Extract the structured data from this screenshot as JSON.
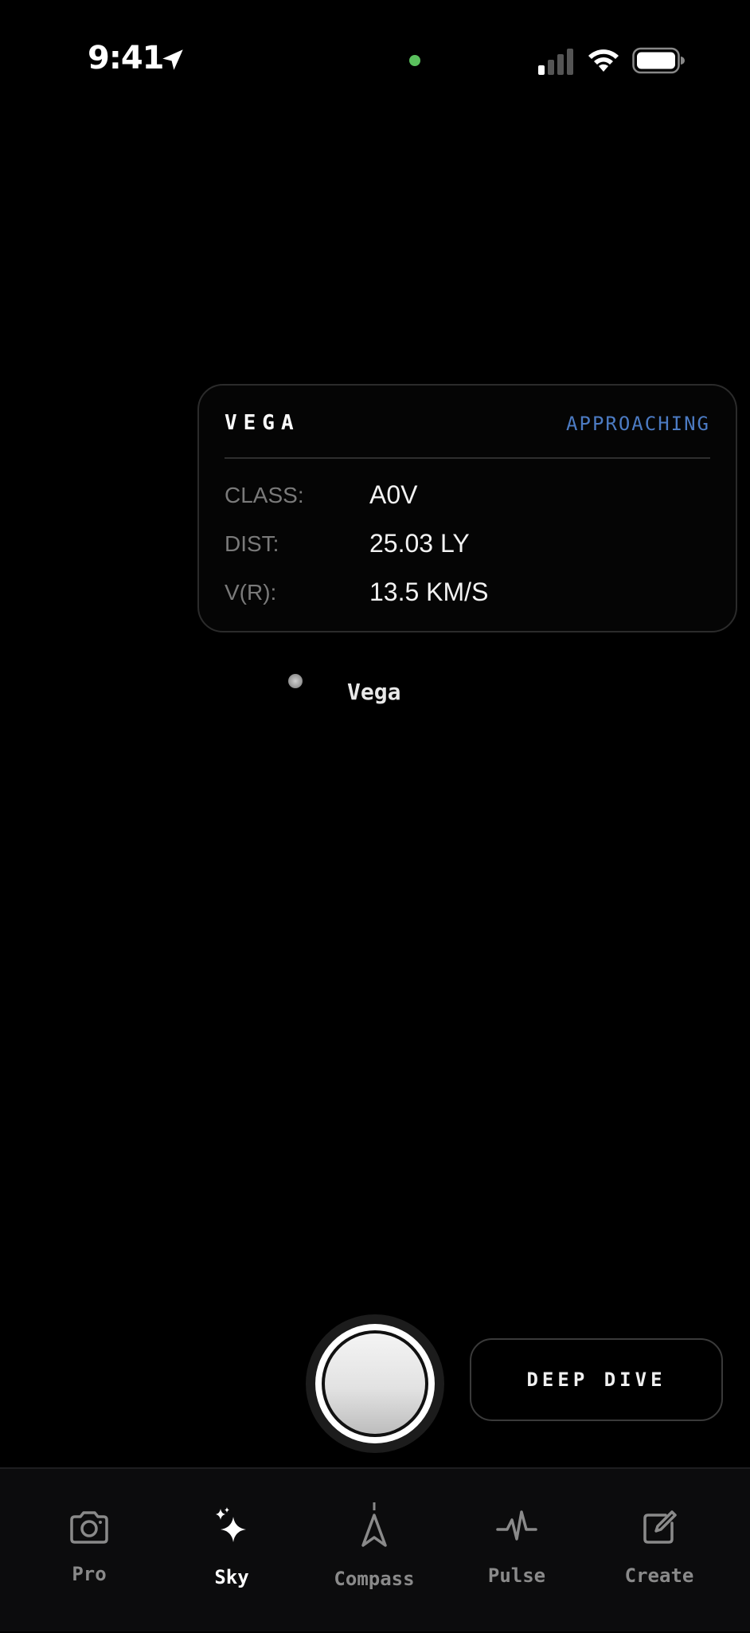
{
  "status_bar": {
    "time": "9:41",
    "icons": [
      "location-arrow-icon",
      "camera-indicator-dot",
      "cellular-signal-icon",
      "wifi-icon",
      "battery-icon"
    ]
  },
  "card": {
    "title": "VEGA",
    "status": "APPROACHING",
    "status_color": "#4c7bc3",
    "rows": [
      {
        "label": "CLASS:",
        "value": "A0V"
      },
      {
        "label": "DIST:",
        "value": "25.03 LY"
      },
      {
        "label": "V(R):",
        "value": "13.5 KM/S"
      }
    ]
  },
  "star": {
    "label": "Vega"
  },
  "actions": {
    "deep_dive_label": "DEEP DIVE"
  },
  "tabs": [
    {
      "label": "Pro",
      "icon": "camera-icon",
      "active": false
    },
    {
      "label": "Sky",
      "icon": "sparkles-icon",
      "active": true
    },
    {
      "label": "Compass",
      "icon": "compass-arrow-icon",
      "active": false
    },
    {
      "label": "Pulse",
      "icon": "pulse-icon",
      "active": false
    },
    {
      "label": "Create",
      "icon": "edit-square-icon",
      "active": false
    }
  ]
}
